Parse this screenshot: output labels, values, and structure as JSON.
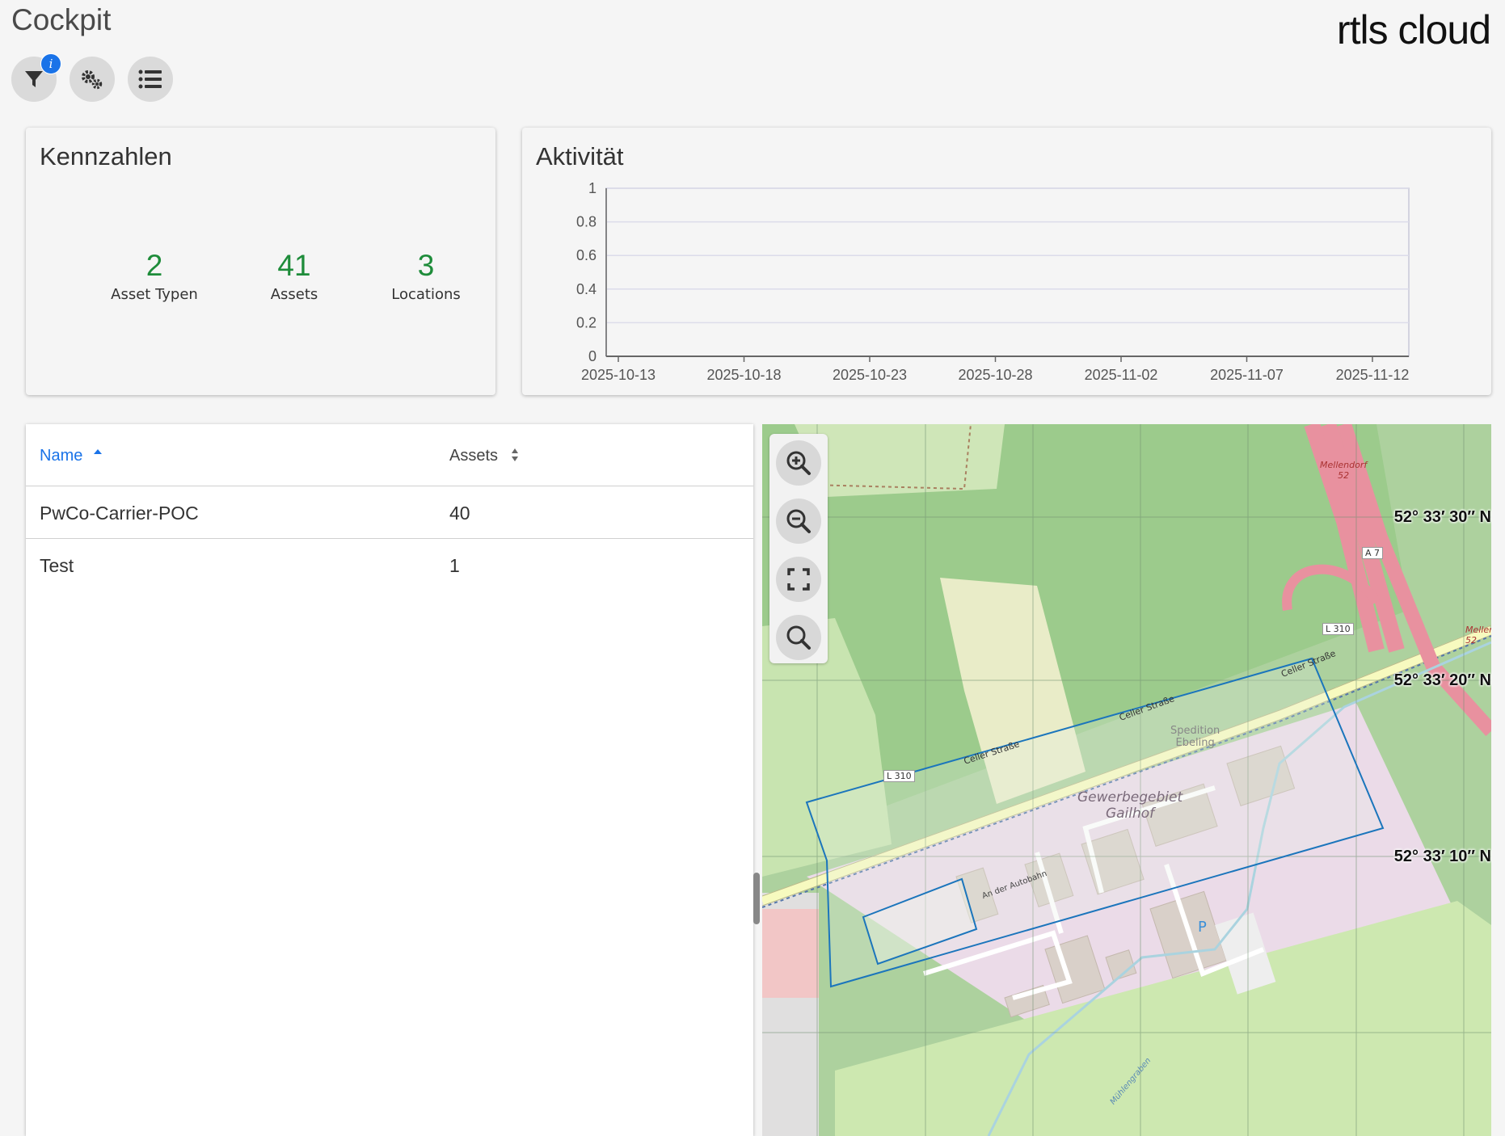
{
  "header": {
    "title": "Cockpit",
    "logo_text": "rtls cloud"
  },
  "toolbar": {
    "filter_badge": "i",
    "buttons": [
      {
        "name": "filter-button",
        "icon": "filter-icon"
      },
      {
        "name": "settings-button",
        "icon": "gears-icon"
      },
      {
        "name": "list-button",
        "icon": "list-icon"
      }
    ]
  },
  "kennzahlen": {
    "title": "Kennzahlen",
    "items": [
      {
        "value": "2",
        "label": "Asset Typen"
      },
      {
        "value": "41",
        "label": "Assets"
      },
      {
        "value": "3",
        "label": "Locations"
      }
    ],
    "value_color": "#1e8c3a"
  },
  "activity": {
    "title": "Aktivität"
  },
  "chart_data": {
    "type": "line",
    "title": "Aktivität",
    "x": [
      "2025-10-13",
      "2025-10-18",
      "2025-10-23",
      "2025-10-28",
      "2025-11-02",
      "2025-11-07",
      "2025-11-12"
    ],
    "yticks": [
      "0",
      "0.2",
      "0.4",
      "0.6",
      "0.8",
      "1"
    ],
    "ylim": [
      0,
      1
    ],
    "series": [],
    "grid": true
  },
  "table": {
    "columns": [
      {
        "label": "Name",
        "sort": "asc"
      },
      {
        "label": "Assets",
        "sort": "none"
      }
    ],
    "rows": [
      {
        "name": "PwCo-Carrier-POC",
        "assets": "40"
      },
      {
        "name": "Test",
        "assets": "1"
      }
    ],
    "link_color": "#1a73e8"
  },
  "map": {
    "controls": [
      {
        "name": "zoom-in-button",
        "icon": "zoom-in-icon"
      },
      {
        "name": "zoom-out-button",
        "icon": "zoom-out-icon"
      },
      {
        "name": "fullscreen-button",
        "icon": "fullscreen-icon"
      },
      {
        "name": "search-button",
        "icon": "search-icon"
      }
    ],
    "coordinates": [
      "52° 33′ 30″ N",
      "52° 33′ 20″ N",
      "52° 33′ 10″ N"
    ],
    "labels": {
      "area": [
        "Gewerbegebiet",
        "Gailhof"
      ],
      "company": [
        "Spedition",
        "Ebeling"
      ],
      "road_1": "Celler Straße",
      "road_2": "Celler Straße",
      "road_3": "Celler Straße",
      "route_1": "L 310",
      "route_2": "L 310",
      "highway": "A 7",
      "street": "An der Autobahn",
      "place_1": "Mellendorf",
      "place_1_num": "52",
      "place_2": "Mellen",
      "place_2_num": "52",
      "water": "Mühlengraben",
      "parking": "P"
    }
  }
}
